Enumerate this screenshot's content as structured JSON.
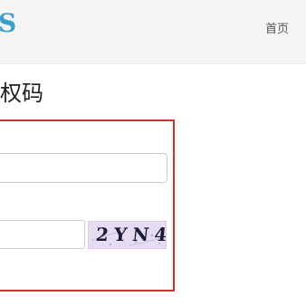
{
  "header": {
    "brand": "S",
    "nav_home": "首页"
  },
  "page": {
    "title": "权码"
  },
  "form": {
    "code_input_value": "",
    "captcha_input_value": "",
    "captcha_text": "2YN4"
  },
  "colors": {
    "brand": "#3aa0c8",
    "form_border": "#d42f2f",
    "captcha_bg": "#e6dcf3"
  }
}
